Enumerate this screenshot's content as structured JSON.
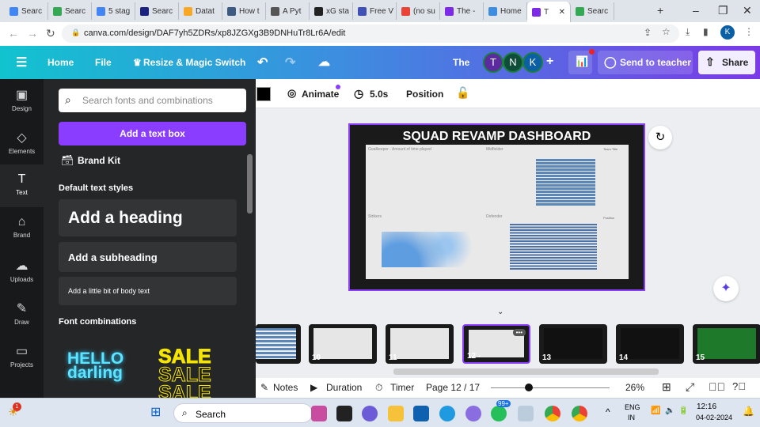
{
  "browser": {
    "tabs": [
      {
        "label": "Searc",
        "color": "#4285f4"
      },
      {
        "label": "Searc",
        "color": "#34a853"
      },
      {
        "label": "5 stag",
        "color": "#4285f4"
      },
      {
        "label": "Searc",
        "color": "#1a237e"
      },
      {
        "label": "Datat",
        "color": "#f9a825"
      },
      {
        "label": "How t",
        "color": "#3d5a80"
      },
      {
        "label": "A Pyt",
        "color": "#555"
      },
      {
        "label": "xG sta",
        "color": "#222"
      },
      {
        "label": "Free V",
        "color": "#3f51b5"
      },
      {
        "label": "(no su",
        "color": "#ea4335"
      },
      {
        "label": "The -",
        "color": "#7d2ae8"
      },
      {
        "label": "Home",
        "color": "#3d8de0"
      },
      {
        "label": "T",
        "color": "#7d2ae8",
        "active": true
      },
      {
        "label": "Searc",
        "color": "#34a853"
      }
    ],
    "new_tab": "+",
    "url": "canva.com/design/DAF7yh5ZDRs/xp8JZGXg3B9DNHuTr8Lr6A/edit",
    "profile": "K"
  },
  "header": {
    "menu_icon": "hamburger-icon",
    "home": "Home",
    "file": "File",
    "resize": "Resize & Magic Switch",
    "title": "The",
    "avatars": [
      {
        "letter": "T",
        "color": "#5b2a9e"
      },
      {
        "letter": "N",
        "color": "#0d4d3a"
      },
      {
        "letter": "K",
        "color": "#0b5fa5"
      }
    ],
    "add": "+",
    "send": "Send to teacher",
    "share": "Share"
  },
  "rail": [
    {
      "label": "Design",
      "icon": "▣"
    },
    {
      "label": "Elements",
      "icon": "◇"
    },
    {
      "label": "Text",
      "icon": "T",
      "active": true
    },
    {
      "label": "Brand",
      "icon": "⌂"
    },
    {
      "label": "Uploads",
      "icon": "☁"
    },
    {
      "label": "Draw",
      "icon": "✎"
    },
    {
      "label": "Projects",
      "icon": "▭"
    }
  ],
  "panel": {
    "search_placeholder": "Search fonts and combinations",
    "add_text_box": "Add a text box",
    "brand_kit": "Brand Kit",
    "default_styles": "Default text styles",
    "heading": "Add a heading",
    "subheading": "Add a subheading",
    "body": "Add a little bit of body text",
    "font_combinations": "Font combinations",
    "combo1": "HELLO darling",
    "combo2": "SALE"
  },
  "toolbar": {
    "animate": "Animate",
    "duration": "5.0s",
    "position": "Position"
  },
  "design": {
    "title": "SQUAD REVAMP DASHBOARD",
    "sections": [
      "Goalkeeper - Amount of time played",
      "Midfielder",
      "Strikers",
      "Defender"
    ],
    "filters": [
      "Team Title",
      "Position"
    ]
  },
  "thumbnails": [
    {
      "n": "10"
    },
    {
      "n": "11"
    },
    {
      "n": "12 -",
      "active": true
    },
    {
      "n": "13"
    },
    {
      "n": "14"
    },
    {
      "n": "15"
    }
  ],
  "bottom": {
    "notes": "Notes",
    "duration": "Duration",
    "timer": "Timer",
    "page": "Page 12 / 17",
    "zoom": "26%",
    "zoom_value": 26
  },
  "taskbar": {
    "search": "Search",
    "badge": "99+",
    "lang1": "ENG",
    "lang2": "IN",
    "time": "12:16",
    "date": "04-02-2024",
    "notif": "1"
  }
}
